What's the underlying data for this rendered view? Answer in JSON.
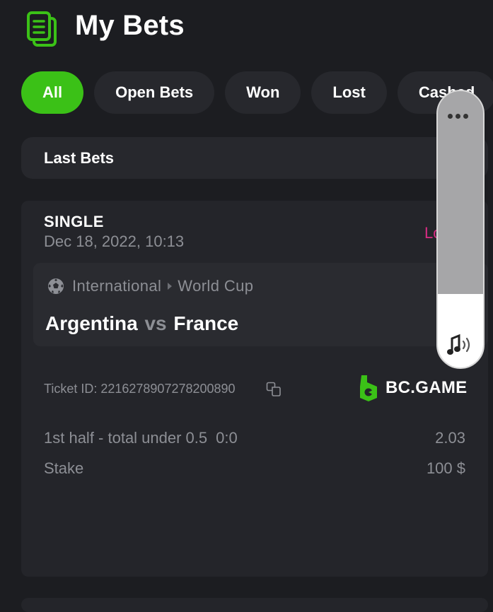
{
  "header": {
    "title": "My Bets",
    "icon": "bets-document-icon",
    "icon_color": "#3bc117"
  },
  "tabs": [
    {
      "label": "All",
      "active": true
    },
    {
      "label": "Open Bets",
      "active": false
    },
    {
      "label": "Won",
      "active": false
    },
    {
      "label": "Lost",
      "active": false
    },
    {
      "label": "Cashed",
      "active": false
    }
  ],
  "filter": {
    "selected": "Last Bets"
  },
  "bet": {
    "type": "SINGLE",
    "date": "Dec 18, 2022, 10:13",
    "status": "Lost",
    "status_color": "#d82c83",
    "category": "International",
    "tournament": "World Cup",
    "home_team": "Argentina",
    "vs": "vs",
    "away_team": "France",
    "ticket_label": "Ticket ID: 2216278907278200890",
    "brand": "BC.GAME",
    "brand_color": "#3bc117",
    "market": "1st half - total under 0.5",
    "score": "0:0",
    "odds": "2.03",
    "stake_label": "Stake",
    "stake_value": "100 $"
  },
  "volume_overlay": {
    "level": 0.265,
    "menu_icon": "more-dots-icon",
    "sound_icon": "volume-music-icon"
  }
}
